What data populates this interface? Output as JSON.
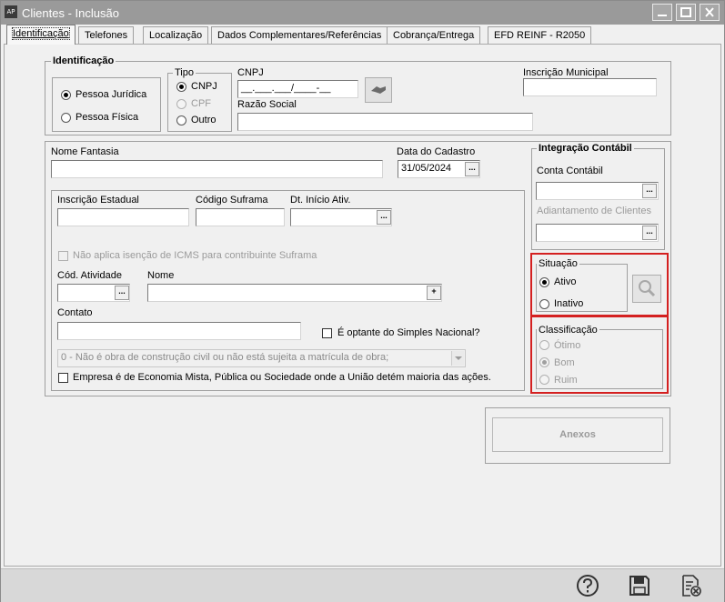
{
  "window": {
    "title": "Clientes - Inclusão",
    "app_icon_text": "AP"
  },
  "tabs": [
    {
      "label": "Identificação",
      "active": true
    },
    {
      "label": "Telefones"
    },
    {
      "label": "Localização"
    },
    {
      "label": "Dados Complementares/Referências"
    },
    {
      "label": "Cobrança/Entrega"
    },
    {
      "label": "EFD REINF - R2050"
    }
  ],
  "identificacao": {
    "group_title": "Identificação",
    "pessoa_juridica": "Pessoa Jurídica",
    "pessoa_fisica": "Pessoa Física",
    "tipo_title": "Tipo",
    "tipo_cnpj": "CNPJ",
    "tipo_cpf": "CPF",
    "tipo_outro": "Outro",
    "cnpj_label": "CNPJ",
    "cnpj_value": "__.___.___/____-__",
    "razao_social_label": "Razão Social",
    "razao_social_value": "",
    "inscricao_municipal_label": "Inscrição Municipal",
    "inscricao_municipal_value": ""
  },
  "main": {
    "nome_fantasia_label": "Nome Fantasia",
    "nome_fantasia_value": "",
    "data_cadastro_label": "Data do Cadastro",
    "data_cadastro_value": "31/05/2024",
    "inscricao_estadual_label": "Inscrição Estadual",
    "codigo_suframa_label": "Código Suframa",
    "dt_inicio_label": "Dt. Início Ativ.",
    "nao_aplica_label": "Não aplica isenção de ICMS para contribuinte Suframa",
    "cod_atividade_label": "Cód. Atividade",
    "nome_label": "Nome",
    "contato_label": "Contato",
    "simples_label": "É optante do Simples Nacional?",
    "obra_select_value": "0 - Não é obra de construção civil ou não está sujeita a matrícula de obra;",
    "economia_mista_label": "Empresa é de Economia Mista, Pública ou Sociedade onde a União detém maioria das ações."
  },
  "integracao": {
    "title": "Integração Contábil",
    "conta_contabil_label": "Conta Contábil",
    "adiantamento_label": "Adiantamento de Clientes"
  },
  "situacao": {
    "title": "Situação",
    "ativo": "Ativo",
    "inativo": "Inativo"
  },
  "classificacao": {
    "title": "Classificação",
    "otimo": "Ótimo",
    "bom": "Bom",
    "ruim": "Ruim"
  },
  "anexos_label": "Anexos",
  "ellipsis": "...",
  "plus": "+",
  "icons": {
    "help": "help-icon",
    "save": "save-icon",
    "cancel": "cancel-document-icon",
    "search": "search-icon"
  },
  "colors": {
    "highlight": "#d42020",
    "titlebar": "#9a9a9a"
  }
}
